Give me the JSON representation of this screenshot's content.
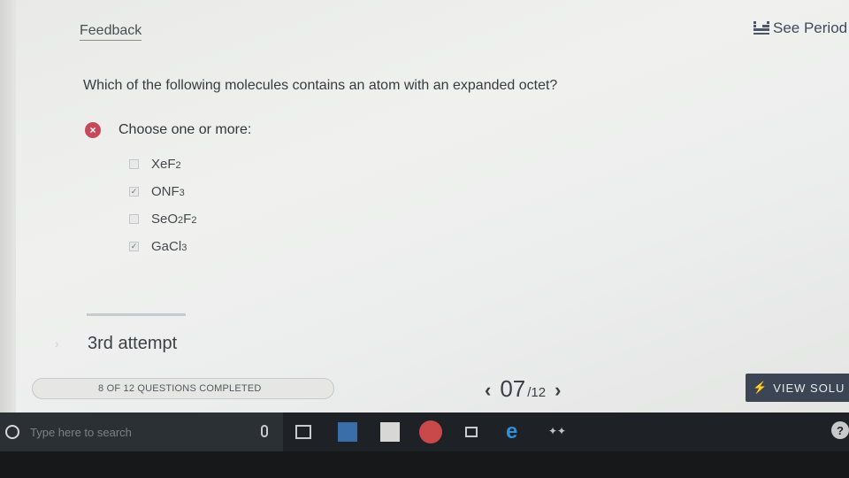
{
  "header": {
    "feedback_label": "Feedback",
    "periodic_label": "See Period"
  },
  "question": {
    "text": "Which of the following molecules contains an atom with an expanded octet?",
    "status_icon": "×",
    "instruction": "Choose one or more:",
    "options": [
      {
        "base": [
          "Xe",
          "F"
        ],
        "sub": [
          "",
          "2"
        ],
        "checked": false
      },
      {
        "base": [
          "ONF"
        ],
        "sub": [
          "3"
        ],
        "checked": true
      },
      {
        "base": [
          "SeO",
          "F"
        ],
        "sub": [
          "2",
          "2"
        ],
        "checked": false
      },
      {
        "base": [
          "GaCl"
        ],
        "sub": [
          "3"
        ],
        "checked": true
      }
    ],
    "option_labels": [
      "XeF2",
      "ONF3",
      "SeO2F2",
      "GaCl3"
    ]
  },
  "attempt": {
    "label": "3rd attempt"
  },
  "footer": {
    "progress_label": "8 OF 12 QUESTIONS COMPLETED",
    "current_page": "07",
    "total_pages": "/12",
    "view_solution_icon": "⚡",
    "view_solution_label": "VIEW SOLU"
  },
  "taskbar": {
    "search_placeholder": "Type here to search",
    "help_glyph": "?"
  }
}
